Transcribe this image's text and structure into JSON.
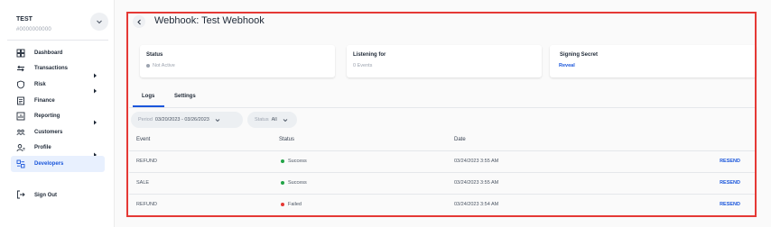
{
  "account": {
    "name": "TEST",
    "id": "#0000000000"
  },
  "sidebar": {
    "items": [
      {
        "label": "Dashboard",
        "icon": "dashboard-icon",
        "has_submenu": false
      },
      {
        "label": "Transactions",
        "icon": "transactions-icon",
        "has_submenu": true
      },
      {
        "label": "Risk",
        "icon": "shield-icon",
        "has_submenu": true
      },
      {
        "label": "Finance",
        "icon": "finance-icon",
        "has_submenu": false
      },
      {
        "label": "Reporting",
        "icon": "reporting-icon",
        "has_submenu": true
      },
      {
        "label": "Customers",
        "icon": "customers-icon",
        "has_submenu": false
      },
      {
        "label": "Profile",
        "icon": "profile-icon",
        "has_submenu": true
      },
      {
        "label": "Developers",
        "icon": "developers-icon",
        "has_submenu": false,
        "active": true
      }
    ],
    "sign_out": "Sign Out"
  },
  "header": {
    "title": "Webhook: Test Webhook"
  },
  "cards": {
    "status": {
      "title": "Status",
      "value": "Not Active"
    },
    "listening": {
      "title": "Listening for",
      "value": "0 Events"
    },
    "signing": {
      "title": "Signing Secret",
      "link": "Reveal"
    }
  },
  "tabs": [
    {
      "label": "Logs",
      "active": true
    },
    {
      "label": "Settings",
      "active": false
    }
  ],
  "filters": {
    "period": {
      "label": "Period",
      "value": "03/20/2023 - 03/26/2023"
    },
    "status": {
      "label": "Status",
      "value": "All"
    }
  },
  "table": {
    "columns": [
      "Event",
      "Status",
      "Date",
      ""
    ],
    "rows": [
      {
        "event": "REFUND",
        "status": "Success",
        "date": "03/24/2023 3:55 AM",
        "action": "RESEND"
      },
      {
        "event": "SALE",
        "status": "Success",
        "date": "03/24/2023 3:55 AM",
        "action": "RESEND"
      },
      {
        "event": "REFUND",
        "status": "Failed",
        "date": "03/24/2023 3:54 AM",
        "action": "RESEND"
      }
    ]
  },
  "colors": {
    "accent": "#1a56db",
    "success": "#22a447",
    "failed": "#e53935",
    "highlight": "#e53935"
  }
}
